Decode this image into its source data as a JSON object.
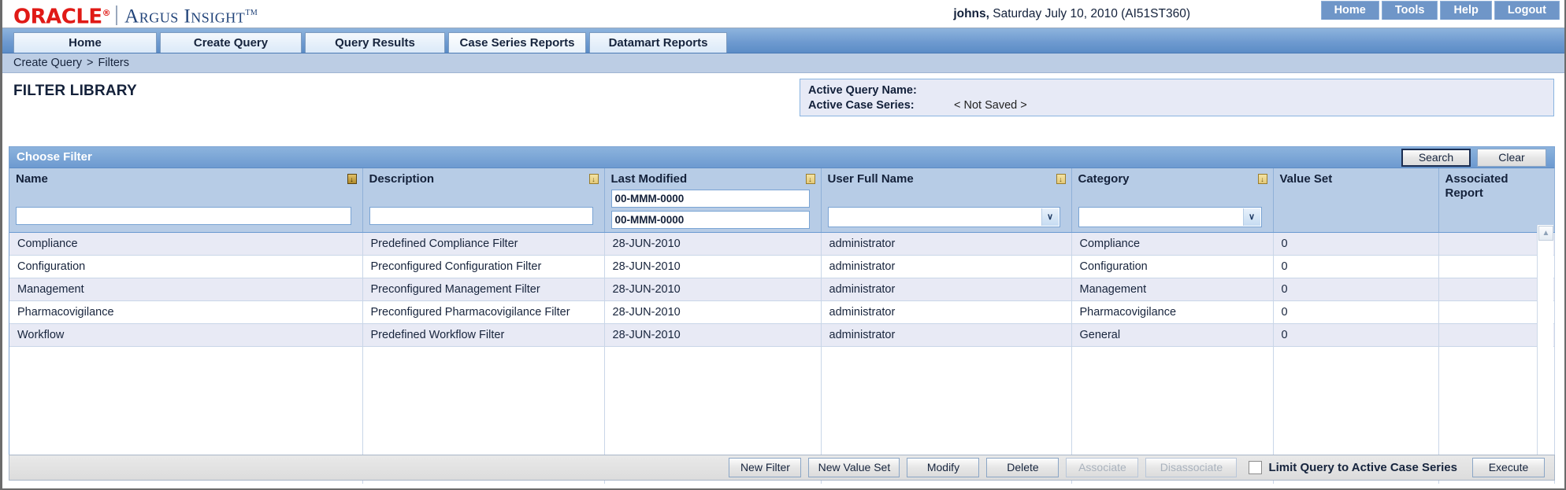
{
  "brand": {
    "oracle": "ORACLE",
    "oracle_mark": "®",
    "product": "Argus Insight",
    "trademark": "TM"
  },
  "header": {
    "user": "johns,",
    "session": " Saturday July 10, 2010 (AI51ST360)",
    "topnav": [
      {
        "label": "Home",
        "name": "top-nav-home"
      },
      {
        "label": "Tools",
        "name": "top-nav-tools"
      },
      {
        "label": "Help",
        "name": "top-nav-help"
      },
      {
        "label": "Logout",
        "name": "top-nav-logout"
      }
    ]
  },
  "tabs": [
    {
      "label": "Home",
      "active": false
    },
    {
      "label": "Create Query",
      "active": false
    },
    {
      "label": "Query Results",
      "active": false
    },
    {
      "label": "Case Series Reports",
      "active": true
    },
    {
      "label": "Datamart Reports",
      "active": false
    }
  ],
  "breadcrumb": {
    "root": "Create Query",
    "separator": ">",
    "current": "Filters"
  },
  "page": {
    "title": "FILTER LIBRARY"
  },
  "active_query_box": {
    "query_name_label": "Active Query Name:",
    "query_name_value": "",
    "case_series_label": "Active Case Series:",
    "case_series_value": "< Not Saved >"
  },
  "panel": {
    "title": "Choose Filter",
    "search_label": "Search",
    "clear_label": "Clear"
  },
  "table": {
    "columns": [
      {
        "label": "Name",
        "sort": "active",
        "filter": "text",
        "value": ""
      },
      {
        "label": "Description",
        "sort": "inactive",
        "filter": "text",
        "value": ""
      },
      {
        "label": "Last Modified",
        "sort": "inactive",
        "filter": "date-range",
        "value_from": "00-MMM-0000",
        "value_to": "00-MMM-0000"
      },
      {
        "label": "User Full Name",
        "sort": "inactive",
        "filter": "select",
        "value": ""
      },
      {
        "label": "Category",
        "sort": "inactive",
        "filter": "select",
        "value": ""
      },
      {
        "label": "Value Set",
        "sort": "none",
        "filter": "none",
        "value": ""
      },
      {
        "label": "Associated Report",
        "sort": "none",
        "filter": "none",
        "value": ""
      }
    ],
    "rows": [
      {
        "name": "Compliance",
        "description": "Predefined Compliance Filter",
        "last_modified": "28-JUN-2010",
        "user_full_name": "administrator",
        "category": "Compliance",
        "value_set": "0",
        "associated_report": ""
      },
      {
        "name": "Configuration",
        "description": "Preconfigured Configuration Filter",
        "last_modified": "28-JUN-2010",
        "user_full_name": "administrator",
        "category": "Configuration",
        "value_set": "0",
        "associated_report": ""
      },
      {
        "name": "Management",
        "description": "Preconfigured Management Filter",
        "last_modified": "28-JUN-2010",
        "user_full_name": "administrator",
        "category": "Management",
        "value_set": "0",
        "associated_report": ""
      },
      {
        "name": "Pharmacovigilance",
        "description": "Preconfigured Pharmacovigilance Filter",
        "last_modified": "28-JUN-2010",
        "user_full_name": "administrator",
        "category": "Pharmacovigilance",
        "value_set": "0",
        "associated_report": ""
      },
      {
        "name": "Workflow",
        "description": "Predefined Workflow Filter",
        "last_modified": "28-JUN-2010",
        "user_full_name": "administrator",
        "category": "General",
        "value_set": "0",
        "associated_report": ""
      }
    ],
    "scroll_up_icon": "▲",
    "scroll_down_icon": "▼"
  },
  "footer": {
    "buttons": [
      {
        "label": "New Filter",
        "disabled": false,
        "name": "new-filter-button",
        "wide": false
      },
      {
        "label": "New Value Set",
        "disabled": false,
        "name": "new-value-set-button",
        "wide": true
      },
      {
        "label": "Modify",
        "disabled": false,
        "name": "modify-button",
        "wide": false
      },
      {
        "label": "Delete",
        "disabled": false,
        "name": "delete-button",
        "wide": false
      },
      {
        "label": "Associate",
        "disabled": true,
        "name": "associate-button",
        "wide": false
      },
      {
        "label": "Disassociate",
        "disabled": true,
        "name": "disassociate-button",
        "wide": true
      }
    ],
    "limit_checkbox_label": "Limit Query to Active Case Series",
    "limit_checked": false,
    "execute_label": "Execute"
  },
  "icons": {
    "sort_down": "↓",
    "select_chevron": "∨"
  },
  "colors": {
    "oracle_red": "#e01a16",
    "brand_blue": "#22447a",
    "panel_header_blue": "#6d9ad0",
    "tab_bar_blue": "#6f9bd0",
    "breadcrumb_blue": "#bccde4",
    "header_cell_blue": "#b7cce6",
    "row_alt": "#e8eaf5"
  }
}
